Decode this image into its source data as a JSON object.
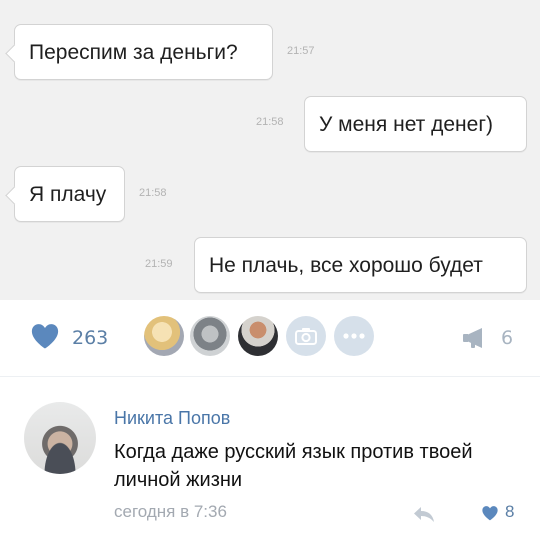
{
  "chat": {
    "messages": [
      {
        "text": "Переспим за деньги?",
        "time": "21:57",
        "side": "in"
      },
      {
        "text": "У меня нет денег)",
        "time": "21:58",
        "side": "out"
      },
      {
        "text": "Я плачу",
        "time": "21:58",
        "side": "in"
      },
      {
        "text": "Не плачь, все хорошо будет",
        "time": "21:59",
        "side": "out"
      }
    ]
  },
  "post_footer": {
    "likes": "263",
    "shares": "6",
    "like_color": "#5b88bd",
    "liker_avatars": [
      "avatar-blonde-girl",
      "avatar-cat",
      "avatar-man"
    ],
    "extra_icons": [
      "camera-icon",
      "more-icon"
    ]
  },
  "comment": {
    "author": "Никита Попов",
    "text": "Когда даже русский язык против твоей личной жизни",
    "date": "сегодня в 7:36",
    "likes": "8",
    "accent": "#4a76a8"
  }
}
